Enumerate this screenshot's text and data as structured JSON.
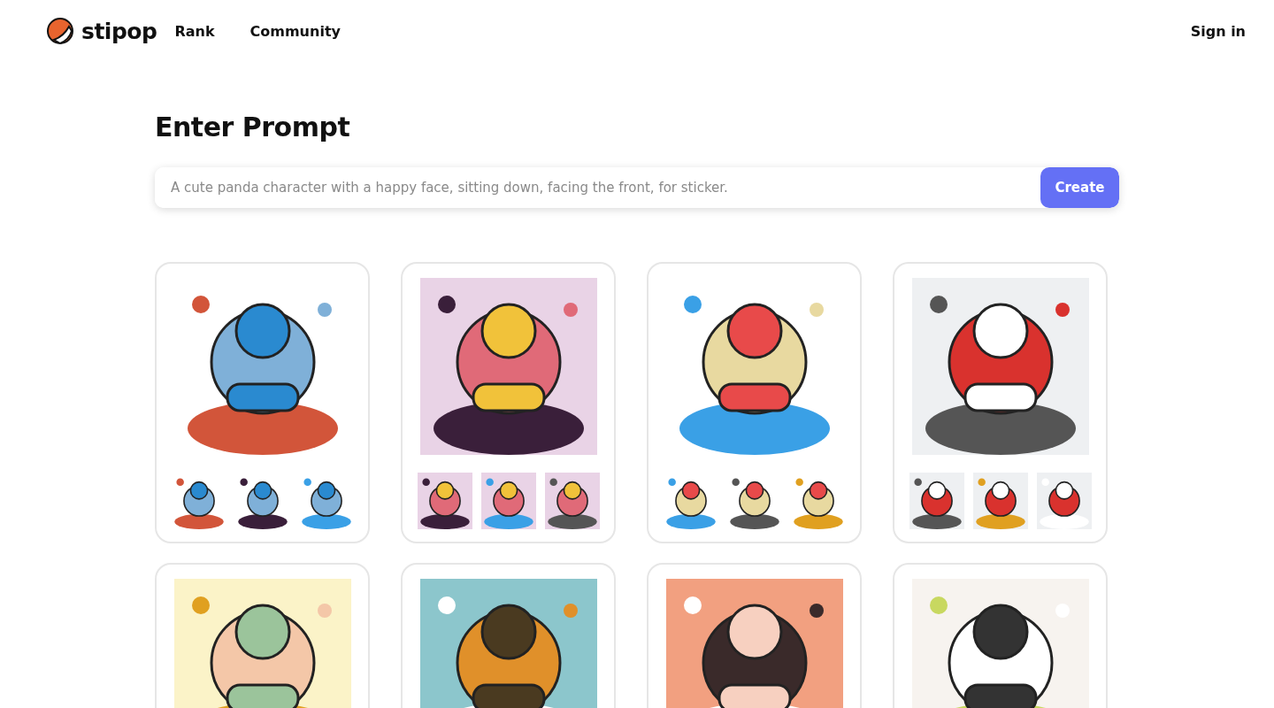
{
  "header": {
    "logo": "stipop",
    "nav": [
      {
        "label": "Rank"
      },
      {
        "label": "Community"
      }
    ],
    "sign_in": "Sign in"
  },
  "title": "Enter Prompt",
  "prompt": {
    "placeholder": "A cute panda character with a happy face, sitting down, facing the front, for sticker.",
    "button": "Create"
  },
  "cards": [
    {
      "kind": "picture",
      "thumbnails": [
        {
          "kind": "picture"
        },
        {
          "kind": "picture"
        },
        {
          "kind": "picture"
        }
      ]
    },
    {
      "kind": "picture",
      "thumbnails": [
        {
          "kind": "picture"
        },
        {
          "kind": "picture"
        },
        {
          "kind": "picture"
        }
      ]
    },
    {
      "kind": "picture",
      "thumbnails": [
        {
          "kind": "picture"
        },
        {
          "kind": "picture"
        },
        {
          "kind": "picture"
        }
      ]
    },
    {
      "kind": "picture",
      "thumbnails": [
        {
          "kind": "picture"
        },
        {
          "kind": "picture"
        },
        {
          "kind": "picture"
        }
      ]
    },
    {
      "kind": "picture"
    },
    {
      "kind": "picture"
    },
    {
      "kind": "picture"
    },
    {
      "kind": "picture"
    }
  ]
}
